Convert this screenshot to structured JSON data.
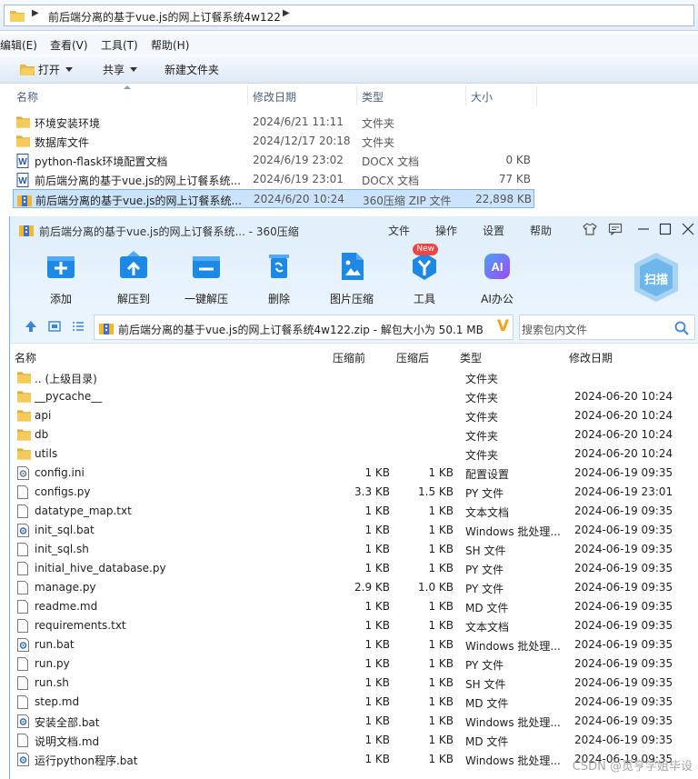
{
  "explorer": {
    "breadcrumb": "前后端分离的基于vue.js的网上订餐系统4w122",
    "menu": [
      "编辑(E)",
      "查看(V)",
      "工具(T)",
      "帮助(H)"
    ],
    "commands": {
      "open": "打开",
      "share": "共享",
      "new_folder": "新建文件夹"
    },
    "columns": {
      "name": "名称",
      "date": "修改日期",
      "type": "类型",
      "size": "大小"
    },
    "rows": [
      {
        "name": "环境安装环境",
        "date": "2024/6/21 11:11",
        "type": "文件夹",
        "size": "",
        "icon": "folder-icon"
      },
      {
        "name": "数据库文件",
        "date": "2024/12/17 20:18",
        "type": "文件夹",
        "size": "",
        "icon": "folder-icon"
      },
      {
        "name": "python-flask环境配置文档",
        "date": "2024/6/19 23:02",
        "type": "DOCX 文档",
        "size": "0 KB",
        "icon": "word-doc-icon"
      },
      {
        "name": "前后端分离的基于vue.js的网上订餐系统...",
        "date": "2024/6/19 23:01",
        "type": "DOCX 文档",
        "size": "77 KB",
        "icon": "word-doc-icon"
      },
      {
        "name": "前后端分离的基于vue.js的网上订餐系统...",
        "date": "2024/6/20 10:24",
        "type": "360压缩 ZIP 文件",
        "size": "22,898 KB",
        "icon": "zip-archive-icon",
        "selected": true
      }
    ]
  },
  "zip": {
    "title": "前后端分离的基于vue.js的网上订餐系统... - 360压缩",
    "title_menu": [
      "文件",
      "操作",
      "设置",
      "帮助"
    ],
    "tools": [
      {
        "label": "添加",
        "icon": "add-icon",
        "color": "#1e88e5"
      },
      {
        "label": "解压到",
        "icon": "extract-to-icon",
        "color": "#1e88e5"
      },
      {
        "label": "一键解压",
        "icon": "one-click-extract-icon",
        "color": "#1e88e5"
      },
      {
        "label": "删除",
        "icon": "delete-icon",
        "color": "#1e88e5"
      },
      {
        "label": "图片压缩",
        "icon": "image-compress-icon",
        "color": "#1e88e5"
      },
      {
        "label": "工具",
        "icon": "tools-icon",
        "color": "#1e88e5",
        "badge": "New"
      },
      {
        "label": "AI办公",
        "icon": "ai-office-icon",
        "color": "#7b4ff0"
      }
    ],
    "scan_label": "扫描",
    "path": "前后端分离的基于vue.js的网上订餐系统4w122.zip - 解包大小为 50.1 MB",
    "search_placeholder": "搜索包内文件",
    "columns": {
      "name": "名称",
      "before": "压缩前",
      "after": "压缩后",
      "type": "类型",
      "date": "修改日期"
    },
    "rows": [
      {
        "name": ".. (上级目录)",
        "before": "",
        "after": "",
        "type": "文件夹",
        "date": "",
        "icon": "folder-icon"
      },
      {
        "name": "__pycache__",
        "before": "",
        "after": "",
        "type": "文件夹",
        "date": "2024-06-20 10:24",
        "icon": "folder-icon"
      },
      {
        "name": "api",
        "before": "",
        "after": "",
        "type": "文件夹",
        "date": "2024-06-20 10:24",
        "icon": "folder-icon"
      },
      {
        "name": "db",
        "before": "",
        "after": "",
        "type": "文件夹",
        "date": "2024-06-20 10:24",
        "icon": "folder-icon"
      },
      {
        "name": "utils",
        "before": "",
        "after": "",
        "type": "文件夹",
        "date": "2024-06-20 10:24",
        "icon": "folder-icon"
      },
      {
        "name": "config.ini",
        "before": "1 KB",
        "after": "1 KB",
        "type": "配置设置",
        "date": "2024-06-19 09:35",
        "icon": "settings-file-icon"
      },
      {
        "name": "configs.py",
        "before": "3.3 KB",
        "after": "1.5 KB",
        "type": "PY 文件",
        "date": "2024-06-19 23:01",
        "icon": "file-icon"
      },
      {
        "name": "datatype_map.txt",
        "before": "1 KB",
        "after": "1 KB",
        "type": "文本文档",
        "date": "2024-06-19 09:35",
        "icon": "file-icon"
      },
      {
        "name": "init_sql.bat",
        "before": "1 KB",
        "after": "1 KB",
        "type": "Windows 批处理...",
        "date": "2024-06-19 09:35",
        "icon": "batch-file-icon"
      },
      {
        "name": "init_sql.sh",
        "before": "1 KB",
        "after": "1 KB",
        "type": "SH 文件",
        "date": "2024-06-19 09:35",
        "icon": "file-icon"
      },
      {
        "name": "initial_hive_database.py",
        "before": "1 KB",
        "after": "1 KB",
        "type": "PY 文件",
        "date": "2024-06-19 09:35",
        "icon": "file-icon"
      },
      {
        "name": "manage.py",
        "before": "2.9 KB",
        "after": "1.0 KB",
        "type": "PY 文件",
        "date": "2024-06-19 09:35",
        "icon": "file-icon"
      },
      {
        "name": "readme.md",
        "before": "1 KB",
        "after": "1 KB",
        "type": "MD 文件",
        "date": "2024-06-19 09:35",
        "icon": "file-icon"
      },
      {
        "name": "requirements.txt",
        "before": "1 KB",
        "after": "1 KB",
        "type": "文本文档",
        "date": "2024-06-19 09:35",
        "icon": "file-icon"
      },
      {
        "name": "run.bat",
        "before": "1 KB",
        "after": "1 KB",
        "type": "Windows 批处理...",
        "date": "2024-06-19 09:35",
        "icon": "batch-file-icon"
      },
      {
        "name": "run.py",
        "before": "1 KB",
        "after": "1 KB",
        "type": "PY 文件",
        "date": "2024-06-19 09:35",
        "icon": "file-icon"
      },
      {
        "name": "run.sh",
        "before": "1 KB",
        "after": "1 KB",
        "type": "SH 文件",
        "date": "2024-06-19 09:35",
        "icon": "file-icon"
      },
      {
        "name": "step.md",
        "before": "1 KB",
        "after": "1 KB",
        "type": "MD 文件",
        "date": "2024-06-19 09:35",
        "icon": "file-icon"
      },
      {
        "name": "安装全部.bat",
        "before": "1 KB",
        "after": "1 KB",
        "type": "Windows 批处理...",
        "date": "2024-06-19 09:35",
        "icon": "batch-file-icon"
      },
      {
        "name": "说明文档.md",
        "before": "1 KB",
        "after": "1 KB",
        "type": "MD 文件",
        "date": "2024-06-19 09:35",
        "icon": "file-icon"
      },
      {
        "name": "运行python程序.bat",
        "before": "1 KB",
        "after": "1 KB",
        "type": "Windows 批处理...",
        "date": "2024-06-19 09:35",
        "icon": "batch-file-icon"
      }
    ]
  },
  "watermark": "CSDN @觅亨学姐毕设"
}
